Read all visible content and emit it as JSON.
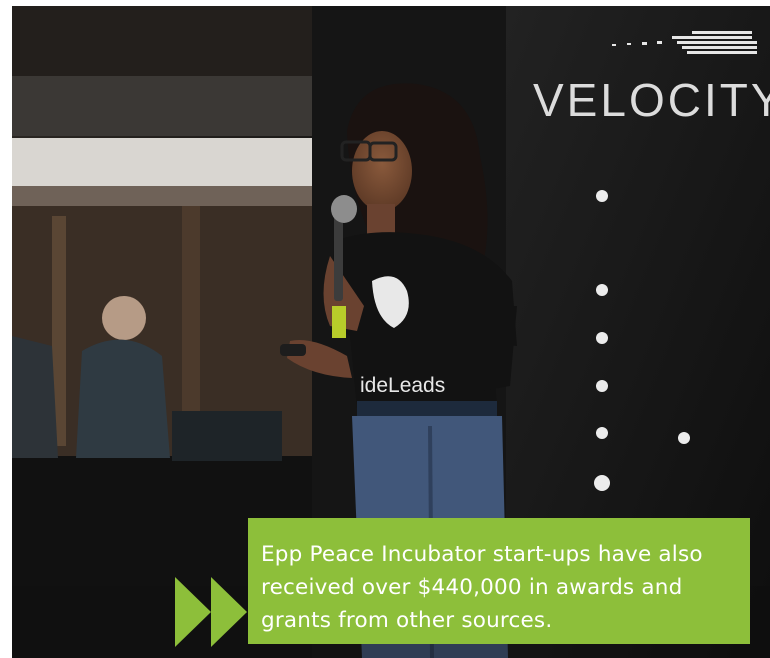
{
  "banner": {
    "brand_text": "VELOCITY"
  },
  "shirt": {
    "text": "ideLeads"
  },
  "caption": {
    "text": "Epp Peace Incubator start-ups have also received over $440,000 in awards and grants from other sources."
  },
  "colors": {
    "caption_bg": "#8dbf3a",
    "caption_text": "#ffffff",
    "arrow": "#8dbf3a",
    "background": "#151515",
    "banner_text": "#dcdcdc"
  },
  "icons": {
    "arrows": "fast-forward-arrows-icon"
  }
}
